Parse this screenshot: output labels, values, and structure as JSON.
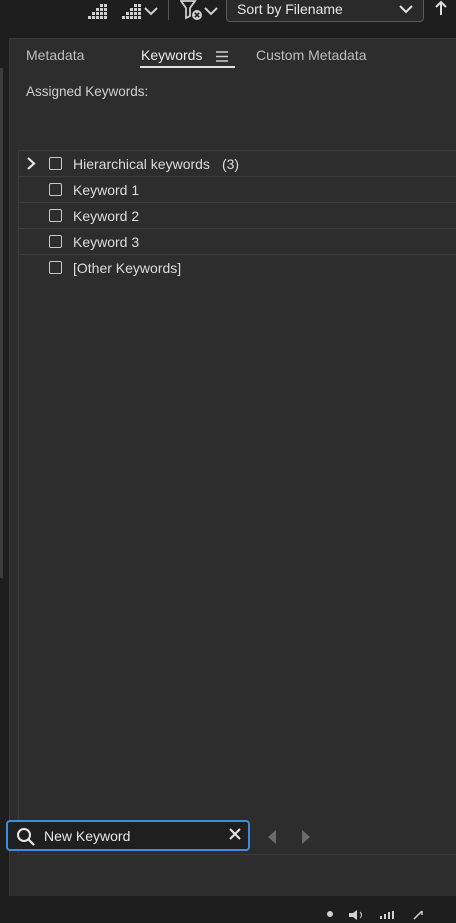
{
  "toolbar": {
    "sort_label": "Sort by Filename"
  },
  "tabs": [
    {
      "label": "Metadata",
      "active": false
    },
    {
      "label": "Keywords",
      "active": true
    },
    {
      "label": "Custom Metadata",
      "active": false
    }
  ],
  "assigned_label": "Assigned Keywords:",
  "keywords": [
    {
      "label": "Hierarchical keywords",
      "count": "(3)",
      "expandable": true,
      "checked": false
    },
    {
      "label": "Keyword 1",
      "checked": false
    },
    {
      "label": "Keyword 2",
      "checked": false
    },
    {
      "label": "Keyword 3",
      "checked": false
    },
    {
      "label": "[Other Keywords]",
      "checked": false
    }
  ],
  "search": {
    "value": "New Keyword"
  },
  "colors": {
    "accent": "#3a8de0",
    "panel_bg": "#2d2d2d",
    "app_bg": "#1e1e1e"
  }
}
